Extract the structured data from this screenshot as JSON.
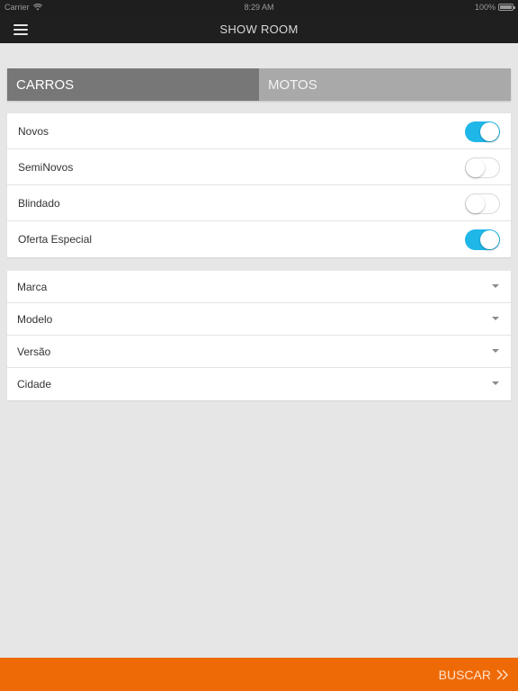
{
  "status_bar": {
    "carrier": "Carrier",
    "time": "8:29 AM",
    "battery": "100%"
  },
  "navbar": {
    "title": "SHOW ROOM",
    "menu_icon": "hamburger-menu-icon"
  },
  "tabs": [
    {
      "label": "CARROS",
      "active": true
    },
    {
      "label": "MOTOS",
      "active": false
    }
  ],
  "filters": [
    {
      "label": "Novos",
      "on": true
    },
    {
      "label": "SemiNovos",
      "on": false
    },
    {
      "label": "Blindado",
      "on": false
    },
    {
      "label": "Oferta Especial",
      "on": true
    }
  ],
  "selects": [
    {
      "label": "Marca"
    },
    {
      "label": "Modelo"
    },
    {
      "label": "Versão"
    },
    {
      "label": "Cidade"
    }
  ],
  "footer": {
    "button_label": "BUSCAR",
    "button_icon": "double-chevron-right-icon"
  },
  "colors": {
    "accent_toggle": "#1fb6e8",
    "footer_orange": "#ee6a07",
    "navbar": "#1f1f1f"
  }
}
